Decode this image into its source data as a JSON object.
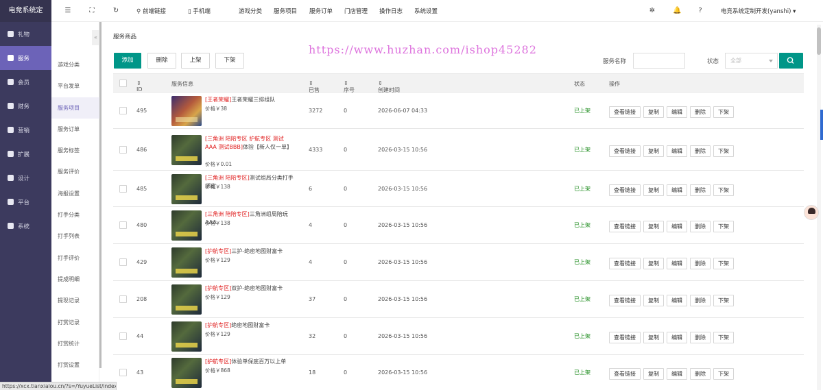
{
  "app": {
    "title": "电竞系统定"
  },
  "sidebar": {
    "items": [
      {
        "label": "礼物",
        "icon": "gift-icon"
      },
      {
        "label": "服务",
        "icon": "service-icon"
      },
      {
        "label": "会员",
        "icon": "member-icon"
      },
      {
        "label": "财务",
        "icon": "finance-icon"
      },
      {
        "label": "营销",
        "icon": "marketing-icon"
      },
      {
        "label": "扩展",
        "icon": "extension-icon"
      },
      {
        "label": "设计",
        "icon": "design-icon"
      },
      {
        "label": "平台",
        "icon": "platform-icon"
      },
      {
        "label": "系统",
        "icon": "system-icon"
      }
    ],
    "active": "服务"
  },
  "subnav": {
    "items": [
      "游戏分类",
      "平台发单",
      "服务项目",
      "服务订单",
      "服务标签",
      "服务评价",
      "海报设置",
      "打手分类",
      "打手列表",
      "打手评价",
      "提成明细",
      "提现记录",
      "打赏记录",
      "打赏统计",
      "打赏设置"
    ],
    "active": "服务项目",
    "collapse": "«"
  },
  "topbar": {
    "frontend_link": "前端链接",
    "mobile": "手机端",
    "menus": [
      "游戏分类",
      "服务项目",
      "服务订单",
      "门店管理",
      "操作日志",
      "系统设置"
    ],
    "user": "电竞系统定制开发(yanshi)"
  },
  "page": {
    "breadcrumb": "服务商品",
    "watermark": "https://www.huzhan.com/ishop45282"
  },
  "toolbar": {
    "add": "添加",
    "delete": "删除",
    "publish": "上架",
    "unpublish": "下架"
  },
  "filters": {
    "name_label": "服务名称",
    "status_label": "状态",
    "status_value": "全部"
  },
  "table": {
    "headers": {
      "id": "ID",
      "info": "服务信息",
      "sold": "已售",
      "order": "序号",
      "created": "创建时间",
      "status": "状态",
      "actions": "操作"
    },
    "action_labels": [
      "查看链接",
      "复制",
      "编辑",
      "删除",
      "下架"
    ],
    "rows": [
      {
        "id": "495",
        "tag": "[王者荣耀]",
        "name": "王者荣耀三排组队",
        "price": "价格￥38",
        "sold": "3272",
        "order": "0",
        "created": "2026-06-07 04:33",
        "status": "已上架",
        "thumb": "hok"
      },
      {
        "id": "486",
        "tag": "[三角洲 陪陪专区 护航专区 测试AAA 测试BBB]",
        "name": "体验【新人仅一单】",
        "price": "价格￥0.01",
        "sold": "4333",
        "order": "0",
        "created": "2026-03-15 10:56",
        "status": "已上架",
        "thumb": "df"
      },
      {
        "id": "485",
        "tag": "[三角洲 陪陪专区]",
        "name": "测试组局分类打手绑定",
        "price": "价格￥138",
        "sold": "6",
        "order": "0",
        "created": "2026-03-15 10:56",
        "status": "已上架",
        "thumb": "df"
      },
      {
        "id": "480",
        "tag": "[三角洲 陪陪专区]",
        "name": "三角洲组局陪玩AAA",
        "price": "价格￥138",
        "sold": "4",
        "order": "0",
        "created": "2026-03-15 10:56",
        "status": "已上架",
        "thumb": "df"
      },
      {
        "id": "429",
        "tag": "[护航专区]",
        "name": "三护-绝密地图财富卡",
        "price": "价格￥129",
        "sold": "4",
        "order": "0",
        "created": "2026-03-15 10:56",
        "status": "已上架",
        "thumb": "df"
      },
      {
        "id": "208",
        "tag": "[护航专区]",
        "name": "双护-绝密地图财富卡",
        "price": "价格￥129",
        "sold": "37",
        "order": "0",
        "created": "2026-03-15 10:56",
        "status": "已上架",
        "thumb": "df"
      },
      {
        "id": "44",
        "tag": "[护航专区]",
        "name": "绝密地图财富卡",
        "price": "价格￥129",
        "sold": "32",
        "order": "0",
        "created": "2026-03-15 10:56",
        "status": "已上架",
        "thumb": "df"
      },
      {
        "id": "43",
        "tag": "[护航专区]",
        "name": "体验单保底百万以上单",
        "price": "价格￥868",
        "sold": "18",
        "order": "0",
        "created": "2026-03-15 10:56",
        "status": "已上架",
        "thumb": "df"
      }
    ]
  },
  "statusbar": {
    "url": "https://xcx.tianxialou.cn/?s=/YuyueList/index"
  }
}
